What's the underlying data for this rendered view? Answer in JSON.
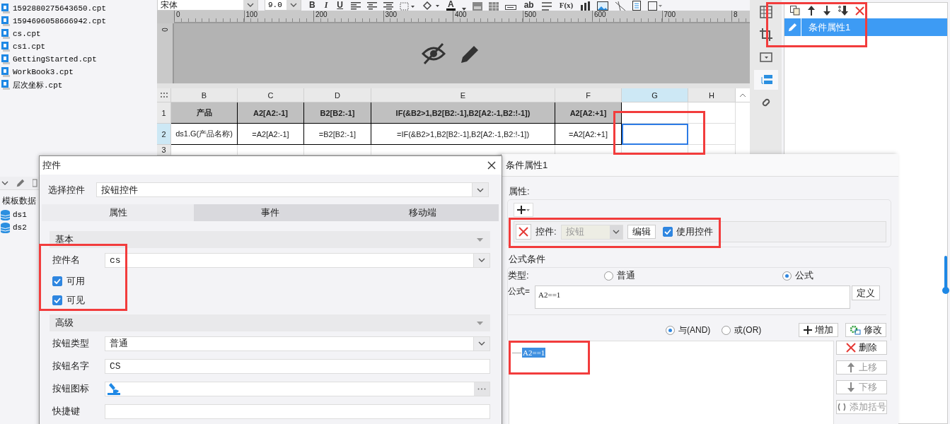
{
  "toolbar": {
    "font": "宋体",
    "font_size": "9.0",
    "format_buttons": [
      "B",
      "I",
      "U"
    ],
    "color_button": "A",
    "text_buttons": [
      "ab",
      "F(x)"
    ]
  },
  "ruler": {
    "labels": [
      "0",
      "100",
      "200",
      "300",
      "400",
      "500",
      "600",
      "700",
      "8"
    ],
    "vertical_label": "0"
  },
  "files": [
    "1592880275643650.cpt",
    "1594696058666942.cpt",
    "cs.cpt",
    "cs1.cpt",
    "GettingStarted.cpt",
    "WorkBook3.cpt",
    "层次坐标.cpt"
  ],
  "datasets": {
    "title": "模板数据",
    "items": [
      "ds1",
      "ds2"
    ]
  },
  "sheet": {
    "columns": [
      {
        "label": "B",
        "selected": false
      },
      {
        "label": "C",
        "selected": false
      },
      {
        "label": "D",
        "selected": false
      },
      {
        "label": "E",
        "selected": false
      },
      {
        "label": "F",
        "selected": false
      },
      {
        "label": "G",
        "selected": true
      },
      {
        "label": "H",
        "selected": false
      }
    ],
    "rows": [
      {
        "label": "1",
        "selected": false,
        "kind": "header",
        "cells": [
          {
            "text": "产品",
            "selected": false
          },
          {
            "text": "A2[A2:-1]",
            "selected": false
          },
          {
            "text": "B2[B2:-1]",
            "selected": false
          },
          {
            "text": "IF(&B2>1,B2[B2:-1],B2[A2:-1,B2:!-1])",
            "selected": false
          },
          {
            "text": "A2[A2:+1]",
            "selected": false
          }
        ]
      },
      {
        "label": "2",
        "selected": true,
        "kind": "data",
        "cells": [
          {
            "text": "ds1.G(产品名称)",
            "selected": false
          },
          {
            "text": "=A2[A2:-1]",
            "selected": false
          },
          {
            "text": "=B2[B2:-1]",
            "selected": false
          },
          {
            "text": "=IF(&B2>1,B2[B2:-1],B2[A2:-1,B2:!-1])",
            "selected": false
          },
          {
            "text": "=A2[A2:+1]",
            "selected": false
          },
          {
            "selected": true
          }
        ]
      },
      {
        "label": "3",
        "selected": false,
        "kind": "data"
      }
    ]
  },
  "right_panel": {
    "items": [
      {
        "label": "条件属性1",
        "selected": true
      }
    ]
  },
  "dialog": {
    "title": "控件",
    "select": {
      "label": "选择控件",
      "value": "按钮控件"
    },
    "tabs": [
      {
        "label": "属性",
        "selected": true
      },
      {
        "label": "事件",
        "selected": false
      },
      {
        "label": "移动端",
        "selected": false
      }
    ],
    "sections": [
      {
        "title": "基本",
        "fields": [
          {
            "kind": "combo",
            "label": "控件名",
            "value": "cs"
          },
          {
            "kind": "checkbox",
            "label": "可用",
            "checked": true
          },
          {
            "kind": "checkbox",
            "label": "可见",
            "checked": true
          }
        ]
      },
      {
        "title": "高级",
        "fields": [
          {
            "kind": "combo",
            "label": "按钮类型",
            "value": "普通"
          },
          {
            "kind": "text",
            "label": "按钮名字",
            "value": "CS"
          },
          {
            "kind": "icon",
            "label": "按钮图标"
          },
          {
            "kind": "text",
            "label": "快捷键"
          }
        ]
      }
    ]
  },
  "condition": {
    "title": "条件属性1",
    "attr_title": "属性:",
    "widget_row": {
      "label": "控件:",
      "value": "按钮",
      "disabled": true,
      "edit_button": "编辑",
      "use_label": "使用控件",
      "use_checked": true
    },
    "formula_title": "公式条件",
    "type_label": "类型:",
    "types": [
      {
        "label": "普通",
        "selected": false
      },
      {
        "label": "公式",
        "selected": true
      }
    ],
    "formula_label": "公式=",
    "formula": "A2==1",
    "define_button": "定义",
    "logic": [
      {
        "label": "与(AND)",
        "selected": true
      },
      {
        "label": "或(OR)",
        "selected": false
      }
    ],
    "add_button": "增加",
    "modify_button": "修改",
    "conditions": [
      {
        "text": "A2==1",
        "selected": true
      }
    ],
    "side_buttons": [
      {
        "kind": "delete",
        "label": "删除",
        "disabled": false
      },
      {
        "kind": "up",
        "label": "上移",
        "disabled": true
      },
      {
        "kind": "down",
        "label": "下移",
        "disabled": true
      },
      {
        "kind": "bracket",
        "label": "添加括号",
        "disabled": true
      }
    ]
  }
}
